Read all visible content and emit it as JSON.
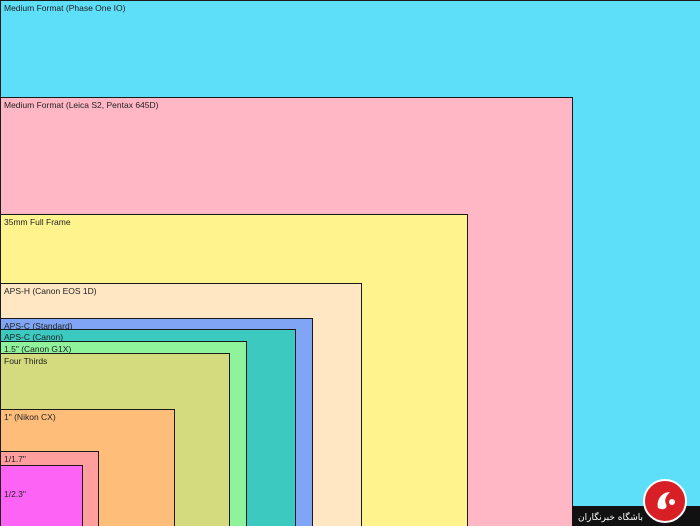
{
  "sensors": [
    {
      "id": "medium-format-phase-one",
      "label": "Medium Format (Phase One IO)",
      "color": "#5ddef9"
    },
    {
      "id": "medium-format-leica",
      "label": "Medium Format (Leica S2, Pentax 645D)",
      "color": "#ffb7c5"
    },
    {
      "id": "full-frame",
      "label": "35mm Full Frame",
      "color": "#fff38e"
    },
    {
      "id": "aps-h",
      "label": "APS-H (Canon EOS 1D)",
      "color": "#ffe7c4"
    },
    {
      "id": "aps-c-standard",
      "label": "APS-C (Standard)",
      "color": "#7fa5f4"
    },
    {
      "id": "aps-c-canon",
      "label": "APS-C (Canon)",
      "color": "#3cc9c0"
    },
    {
      "id": "one-five-inch",
      "label": "1.5\" (Canon G1X)",
      "color": "#8ef39a"
    },
    {
      "id": "four-thirds",
      "label": "Four Thirds",
      "color": "#d4da7e"
    },
    {
      "id": "one-inch",
      "label": "1\" (Nikon CX)",
      "color": "#ffbd7a"
    },
    {
      "id": "one-over-1-7",
      "label": "1/1.7\"",
      "color": "#ff9f9d"
    },
    {
      "id": "one-over-2-3",
      "label": "1/2.3\"",
      "color": "#fd64f5"
    }
  ],
  "watermark": {
    "text": "باشگاه خبرنگاران",
    "bar_color": "#111111",
    "logo_color": "#d91f26"
  }
}
